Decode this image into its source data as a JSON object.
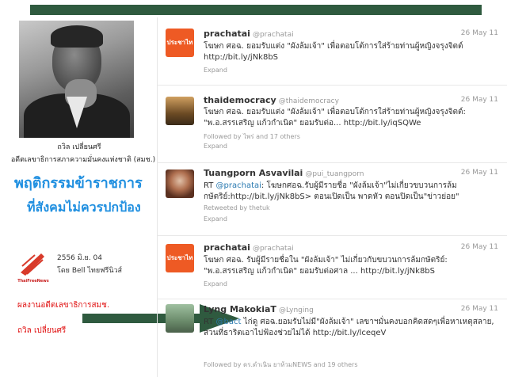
{
  "left_panel": {
    "photo_caption_name": "ถวิล เปลี่ยนศรี",
    "photo_caption_title": "อดีตเลขาธิการสภาความมั่นคงแห่งชาติ (สมช.)",
    "headline_line1": "พฤติกรรมข้าราชการ",
    "headline_line2": "ที่สังคมไม่ควรปกป้อง",
    "logo_text": "ThaiFreeNews",
    "date": "2556 มิ.ย. 04",
    "byline": "โดย Bell ไทยฟรีนิวส์",
    "red_note1": "ผลงานอดีตเลขาธิการสมช.",
    "red_note2": "ถวิล เปลี่ยนศรี"
  },
  "tweets": [
    {
      "avatar": "prachatai-logo",
      "avatar_text": "ประชาไท",
      "name": "prachatai",
      "handle": "@prachatai",
      "date": "26 May 11",
      "text": "โฆษก ศอฉ. ยอมรับแต่ง \"ผังล้มเจ้า\" เพื่อตอบโต้การใส่ร้ายท่านผู้หญิงจรุงจิตต์ http://bit.ly/jNk8bS",
      "meta": "",
      "expand": "Expand"
    },
    {
      "avatar": "thaidemocracy-avatar",
      "name": "thaidemocracy",
      "handle": "@thaidemocracy",
      "date": "26 May 11",
      "text": "โฆษก ศอฉ. ยอมรับแต่ง \"ผังล้มเจ้า\" เพื่อตอบโต้การใส่ร้ายท่านผู้หญิงจรุงจิตต์: \"พ.อ.สรรเสริญ แก้วกำเนิด\" ยอมรับต่อ... http://bit.ly/iqSQWe",
      "meta": "Followed by ไพร่ and 17 others",
      "expand": "Expand"
    },
    {
      "avatar": "tuangporn-avatar",
      "name": "Tuangporn Asvavilai",
      "handle": "@pui_tuangporn",
      "date": "26 May 11",
      "mention": "@prachatai",
      "text": ": โฆษกศอฉ.รับผู้มีรายชื่อ \"ผังล้มเจ้า\"ไม่เกี่ยวขบวนการล้มกษัตริย์:http://bit.ly/jNk8bS> ตอนเปิดเป็น พาดหัว ตอนปิดเป็น\"ข่าวย่อย\"",
      "meta": "Retweeted by thetuk",
      "expand": "Expand"
    },
    {
      "avatar": "prachatai-logo",
      "avatar_text": "ประชาไท",
      "name": "prachatai",
      "handle": "@prachatai",
      "date": "26 May 11",
      "text": "โฆษก ศอฉ. รับผู้มีรายชื่อใน \"ผังล้มเจ้า\" ไม่เกี่ยวกับขบวนการล้มกษัตริย์: \"พ.อ.สรรเสริญ แก้วกำเนิด\" ยอมรับต่อศาล ... http://bit.ly/jNk8bS",
      "meta": "",
      "expand": "Expand"
    },
    {
      "avatar": "lyng-avatar",
      "name": "Lyng MakokiaT",
      "handle": "@Lynging",
      "date": "26 May 11",
      "mention": "@bact",
      "text": "ไก่ดู ศอฉ.ยอมรับไม่มี\"ผังล้มเจ้า\" เลขาฯมั่นคงบอกคิดสดๆเพื่อหาเหตุสลาย, ส่วนที่ธาริตเอาไปฟ้องช่วยไม่ได้ http://bit.ly/lceqeV",
      "meta": "Followed by ดร.ดำเนิน ยาห้วมNEWS and 19 others",
      "expand": "Expand"
    }
  ],
  "colors": {
    "accent": "#1f8fe0",
    "red": "#e01010",
    "bar": "#2f5a3f",
    "arrow": "#2f5a3f"
  }
}
